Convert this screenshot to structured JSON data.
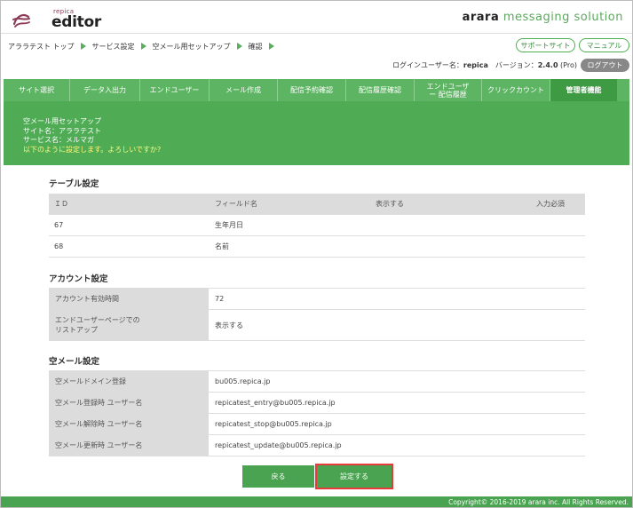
{
  "header": {
    "logo_small": "repica",
    "logo_big": "editor",
    "brand_bold": "arara",
    "brand_rest": " messaging solution"
  },
  "breadcrumb": [
    "アララテスト トップ",
    "サービス設定",
    "空メール用セットアップ",
    "確認"
  ],
  "top_links": {
    "support": "サポートサイト",
    "manual": "マニュアル"
  },
  "user_info": {
    "label": "ログインユーザー名：",
    "username": "repica",
    "version_label": "　バージョン：",
    "version": "2.4.0",
    "edition": " (Pro)",
    "logout": "ログアウト"
  },
  "nav": {
    "tabs": [
      {
        "label": "サイト選択"
      },
      {
        "label": "データ入出力"
      },
      {
        "label": "エンドユーザー"
      },
      {
        "label": "メール作成"
      },
      {
        "label": "配信予約確認"
      },
      {
        "label": "配信履歴確認"
      },
      {
        "label": "エンドユーザー 配信履歴"
      },
      {
        "label": "クリックカウント"
      },
      {
        "label": "管理者機能",
        "active": true
      }
    ]
  },
  "banner": {
    "line1": "空メール用セットアップ",
    "line2": "サイト名：アララテスト",
    "line3": "サービス名：メルマガ",
    "line4": "以下のように設定します。よろしいですか?"
  },
  "table_settings": {
    "title": "テーブル設定",
    "headers": {
      "id": "ＩＤ",
      "field": "フィールド名",
      "show": "表示する",
      "required": "入力必須"
    },
    "rows": [
      {
        "id": "67",
        "field": "生年月日",
        "show": "",
        "required": ""
      },
      {
        "id": "68",
        "field": "名前",
        "show": "",
        "required": ""
      }
    ]
  },
  "account_settings": {
    "title": "アカウント設定",
    "rows": [
      {
        "key": "アカウント有効時間",
        "value": "72"
      },
      {
        "key": "エンドユーザーページでの\nリストアップ",
        "value": "表示する"
      }
    ]
  },
  "empty_mail_settings": {
    "title": "空メール設定",
    "rows": [
      {
        "key": "空メールドメイン登録",
        "value": "bu005.repica.jp"
      },
      {
        "key": "空メール登録時 ユーザー名",
        "value": "repicatest_entry@bu005.repica.jp"
      },
      {
        "key": "空メール解除時 ユーザー名",
        "value": "repicatest_stop@bu005.repica.jp"
      },
      {
        "key": "空メール更新時 ユーザー名",
        "value": "repicatest_update@bu005.repica.jp"
      }
    ]
  },
  "buttons": {
    "back": "戻る",
    "submit": "設定する"
  },
  "footer": {
    "copyright": "Copyright© 2016-2019 arara inc. All Rights Reserved."
  },
  "colors": {
    "primary_green": "#4fac55",
    "active_tab": "#3e9a43",
    "highlight_red": "#e83a3a",
    "warning_yellow": "#fff77a"
  }
}
